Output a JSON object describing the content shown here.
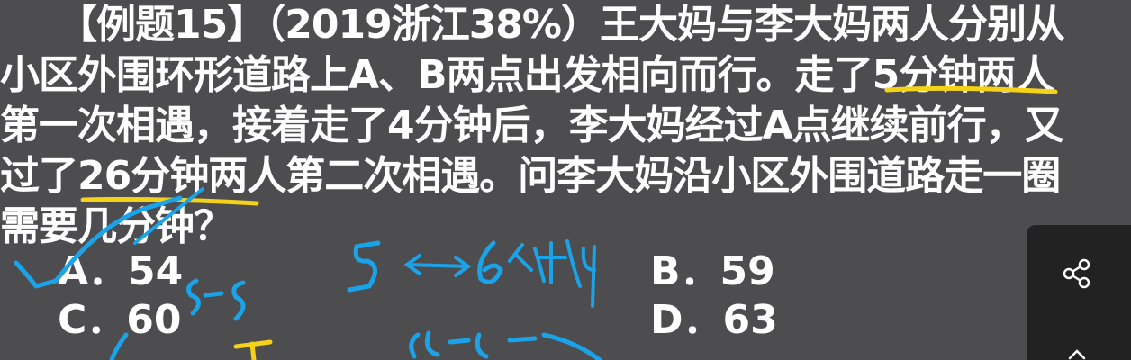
{
  "question": {
    "line1": "　　【例题15】（2019浙江38%）王大妈与李大妈两人分别从",
    "line2": "小区外围环形道路上A、B两点出发相向而行。走了5分钟两人",
    "line3": "第一次相遇，接着走了4分钟后，李大妈经过A点继续前行，又",
    "line4": "过了26分钟两人第二次相遇。问李大妈沿小区外围道路走一圈",
    "line5": "需要几分钟？"
  },
  "options": {
    "a": "A．54",
    "b": "B．59",
    "c": "C．60",
    "d": "D．63"
  },
  "annotations": {
    "pen_color": "#1aa3e8",
    "highlight_color": "#f5d21a"
  },
  "controls": {
    "share_icon": "share-icon"
  }
}
